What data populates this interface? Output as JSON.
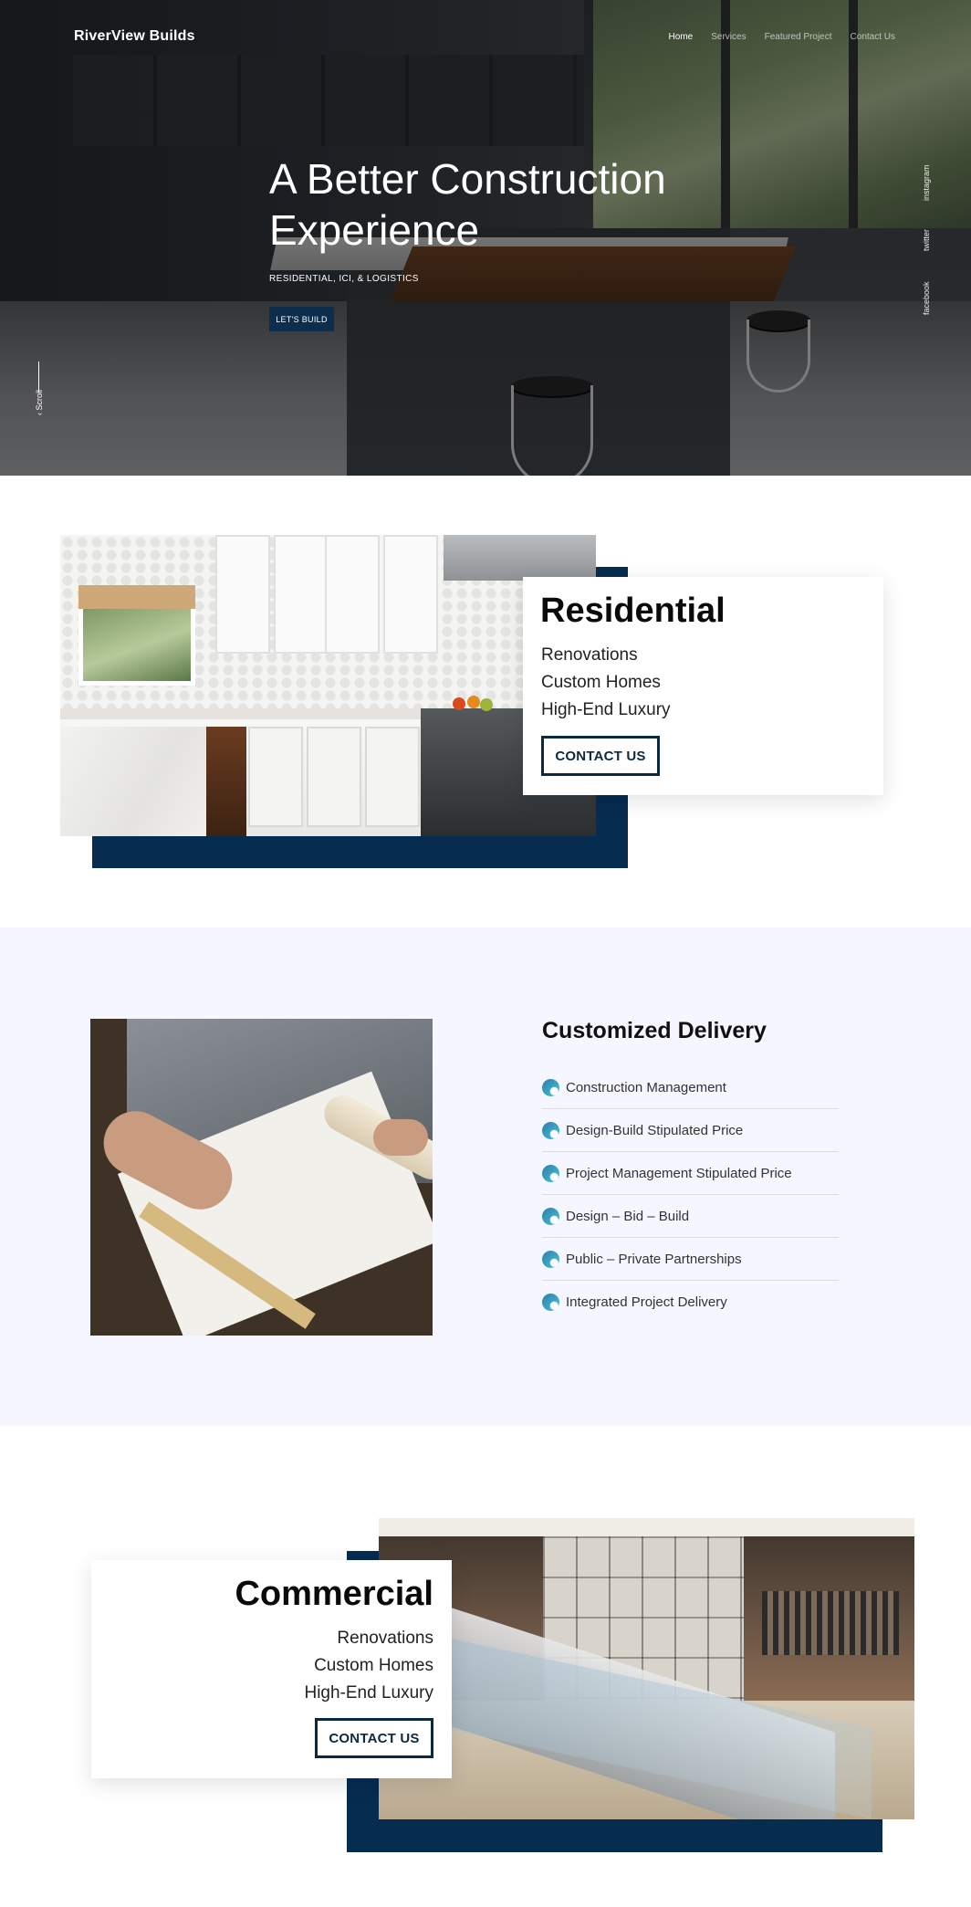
{
  "header": {
    "brand": "RiverView Builds",
    "nav": [
      "Home",
      "Services",
      "Featured Project",
      "Contact Us"
    ]
  },
  "hero": {
    "title_line1": "A Better Construction",
    "title_line2": "Experience",
    "subtitle": "RESIDENTIAL, ICI, & LOGISTICS",
    "cta": "LET'S BUILD",
    "social": [
      "instagram",
      "twitter",
      "facebook"
    ],
    "scroll_label": "Scroll"
  },
  "residential": {
    "title": "Residential",
    "items": [
      "Renovations",
      "Custom Homes",
      "High-End Luxury"
    ],
    "button": "CONTACT US"
  },
  "delivery": {
    "title": "Customized Delivery",
    "items": [
      "Construction Management",
      "Design-Build Stipulated Price",
      "Project Management Stipulated Price",
      "Design – Bid – Build",
      "Public – Private Partnerships",
      "Integrated Project Delivery"
    ],
    "icon": "wave-icon"
  },
  "commercial": {
    "title": "Commercial",
    "items": [
      "Renovations",
      "Custom Homes",
      "High-End Luxury"
    ],
    "button": "CONTACT US"
  },
  "colors": {
    "navy": "#062c50",
    "button_navy": "#0d2d4c",
    "section_bg": "#f5f6ff"
  }
}
